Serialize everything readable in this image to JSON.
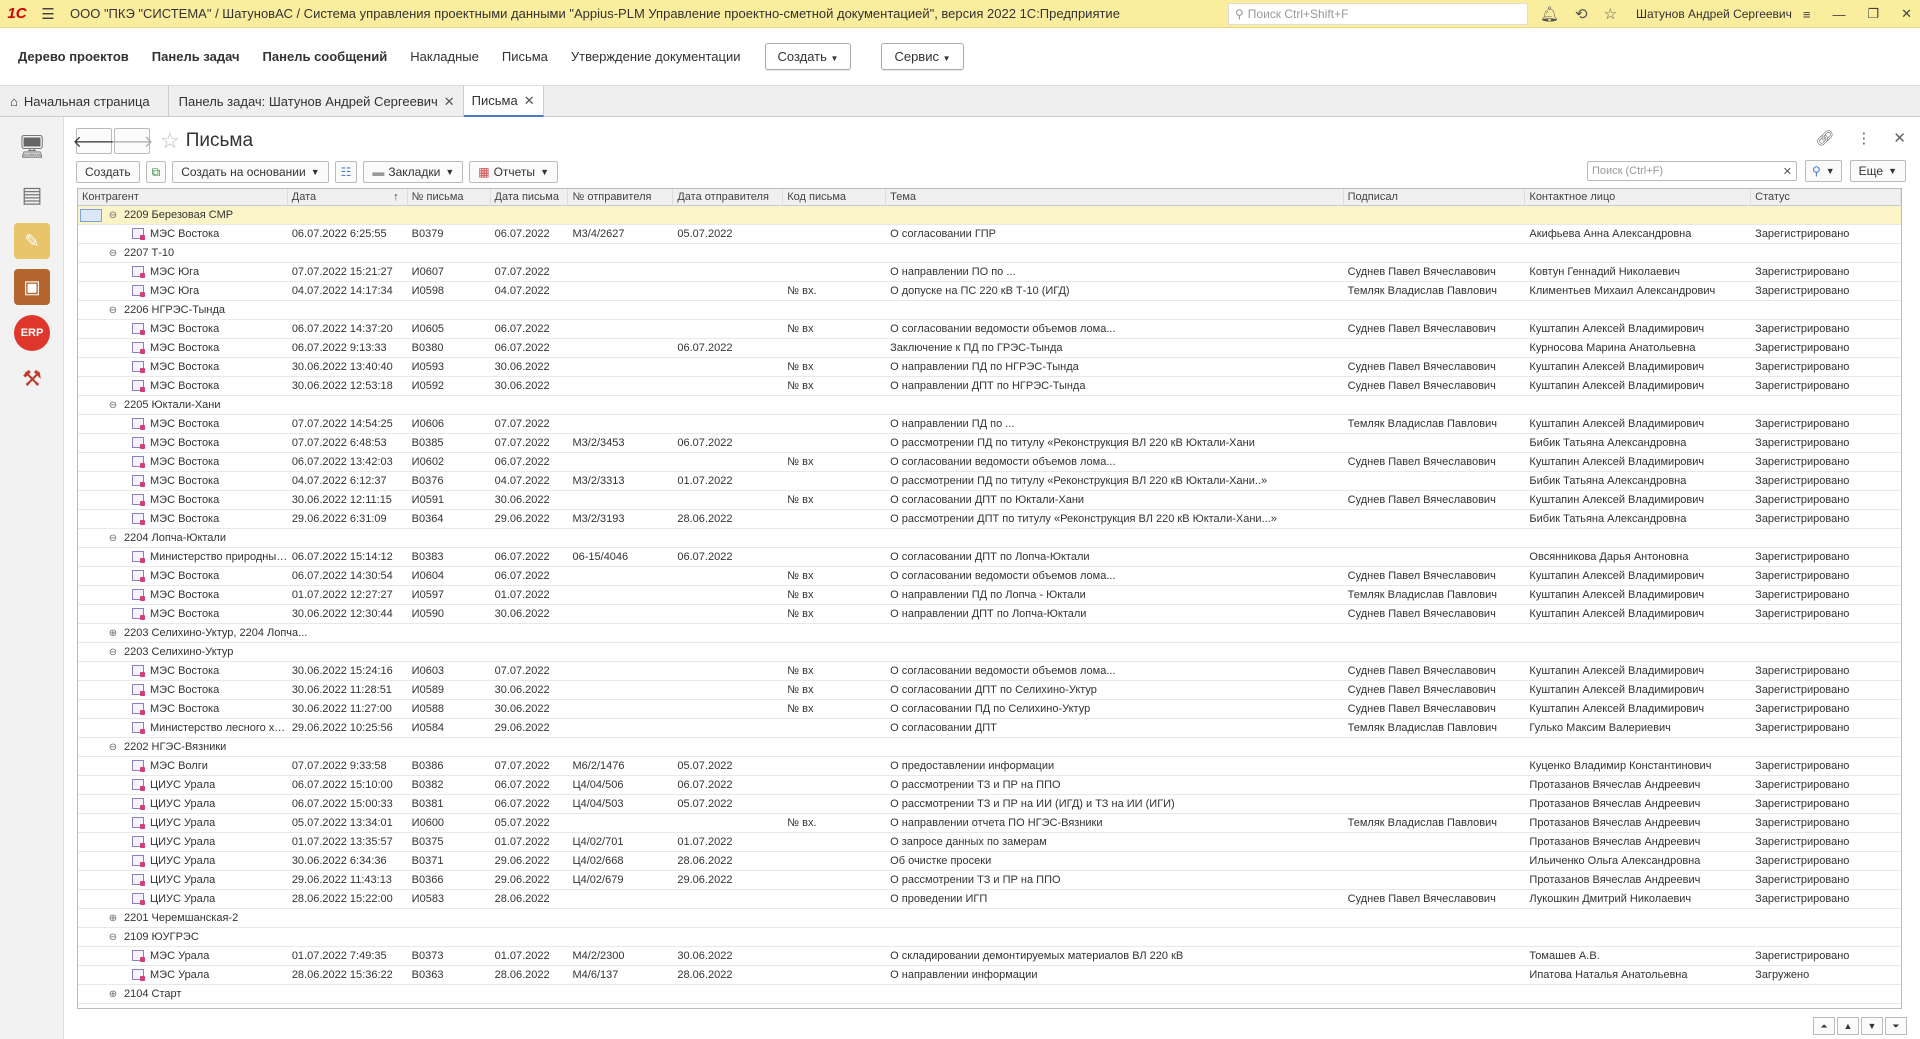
{
  "window": {
    "logo": "1С",
    "title": "ООО \"ПКЭ \"СИСТЕМА\" / ШатуновАС / Система управления проектными данными \"Appius-PLM Управление проектно-сметной документацией\", версия 2022 1С:Предприятие",
    "search_placeholder": "Поиск Ctrl+Shift+F",
    "user": "Шатунов Андрей Сергеевич"
  },
  "menu": {
    "items": [
      "Дерево проектов",
      "Панель задач",
      "Панель сообщений",
      "Накладные",
      "Письма",
      "Утверждение документации"
    ],
    "create": "Создать",
    "service": "Сервис"
  },
  "tabs": [
    "Начальная страница",
    "Панель задач: Шатунов Андрей Сергеевич",
    "Письма"
  ],
  "form": {
    "title": "Письма",
    "buttons": {
      "create": "Создать",
      "create_based": "Создать на основании",
      "bookmarks": "Закладки",
      "reports": "Отчеты",
      "more": "Еще"
    },
    "search_placeholder": "Поиск (Ctrl+F)"
  },
  "table": {
    "columns": [
      "Контрагент",
      "Дата",
      "№ письма",
      "Дата письма",
      "№ отправителя",
      "Дата отправителя",
      "Код письма",
      "Тема",
      "Подписал",
      "Контактное лицо",
      "Статус"
    ],
    "rows": [
      {
        "group": "2209 Березовая СМР",
        "open": true
      },
      {
        "cells": [
          "МЭС Востока",
          "06.07.2022 6:25:55",
          "В0379",
          "06.07.2022",
          "М3/4/2627",
          "05.07.2022",
          "",
          "О согласовании ГПР",
          "",
          "Акифьева Анна Александровна",
          "Зарегистрировано"
        ]
      },
      {
        "group": "2207 Т-10",
        "open": true
      },
      {
        "cells": [
          "МЭС Юга",
          "07.07.2022 15:21:27",
          "И0607",
          "07.07.2022",
          "",
          "",
          "",
          "О направлении ПО по ...",
          "Суднев Павел Вячеславович",
          "Ковтун Геннадий Николаевич",
          "Зарегистрировано"
        ]
      },
      {
        "cells": [
          "МЭС Юга",
          "04.07.2022 14:17:34",
          "И0598",
          "04.07.2022",
          "",
          "",
          "№ вх.",
          "О допуске на ПС 220 кВ Т-10 (ИГД)",
          "Темляк Владислав Павлович",
          "Климентьев Михаил Александрович",
          "Зарегистрировано"
        ]
      },
      {
        "group": "2206 НГРЭС-Тында",
        "open": true
      },
      {
        "cells": [
          "МЭС Востока",
          "06.07.2022 14:37:20",
          "И0605",
          "06.07.2022",
          "",
          "",
          "№ вх",
          "О согласовании ведомости объемов лома...",
          "Суднев Павел Вячеславович",
          "Куштапин Алексей Владимирович",
          "Зарегистрировано"
        ]
      },
      {
        "cells": [
          "МЭС Востока",
          "06.07.2022 9:13:33",
          "В0380",
          "06.07.2022",
          "",
          "06.07.2022",
          "",
          "Заключение к ПД по ГРЭС-Тында",
          "",
          "Курносова Марина Анатольевна",
          "Зарегистрировано"
        ]
      },
      {
        "cells": [
          "МЭС Востока",
          "30.06.2022 13:40:40",
          "И0593",
          "30.06.2022",
          "",
          "",
          "№ вх",
          "О направлении ПД по НГРЭС-Тында",
          "Суднев Павел Вячеславович",
          "Куштапин Алексей Владимирович",
          "Зарегистрировано"
        ]
      },
      {
        "cells": [
          "МЭС Востока",
          "30.06.2022 12:53:18",
          "И0592",
          "30.06.2022",
          "",
          "",
          "№ вх",
          "О направлении ДПТ по НГРЭС-Тында",
          "Суднев Павел Вячеславович",
          "Куштапин Алексей Владимирович",
          "Зарегистрировано"
        ]
      },
      {
        "group": "2205 Юктали-Хани",
        "open": true
      },
      {
        "cells": [
          "МЭС Востока",
          "07.07.2022 14:54:25",
          "И0606",
          "07.07.2022",
          "",
          "",
          "",
          "О направлении ПД по ...",
          "Темляк Владислав Павлович",
          "Куштапин Алексей Владимирович",
          "Зарегистрировано"
        ]
      },
      {
        "cells": [
          "МЭС Востока",
          "07.07.2022 6:48:53",
          "В0385",
          "07.07.2022",
          "М3/2/3453",
          "06.07.2022",
          "",
          "О рассмотрении ПД по титулу «Реконструкция ВЛ 220 кВ Юктали-Хани",
          "",
          "Бибик Татьяна Александровна",
          "Зарегистрировано"
        ]
      },
      {
        "cells": [
          "МЭС Востока",
          "06.07.2022 13:42:03",
          "И0602",
          "06.07.2022",
          "",
          "",
          "№ вх",
          "О согласовании ведомости объемов лома...",
          "Суднев Павел Вячеславович",
          "Куштапин Алексей Владимирович",
          "Зарегистрировано"
        ]
      },
      {
        "cells": [
          "МЭС Востока",
          "04.07.2022 6:12:37",
          "В0376",
          "04.07.2022",
          "М3/2/3313",
          "01.07.2022",
          "",
          "О рассмотрении ПД по титулу «Реконструкция ВЛ 220 кВ Юктали-Хани..»",
          "",
          "Бибик Татьяна Александровна",
          "Зарегистрировано"
        ]
      },
      {
        "cells": [
          "МЭС Востока",
          "30.06.2022 12:11:15",
          "И0591",
          "30.06.2022",
          "",
          "",
          "№ вх",
          "О согласовании ДПТ по Юктали-Хани",
          "Суднев Павел Вячеславович",
          "Куштапин Алексей Владимирович",
          "Зарегистрировано"
        ]
      },
      {
        "cells": [
          "МЭС Востока",
          "29.06.2022 6:31:09",
          "В0364",
          "29.06.2022",
          "М3/2/3193",
          "28.06.2022",
          "",
          "О рассмотрении ДПТ по титулу «Реконструкция ВЛ 220 кВ Юктали-Хани...»",
          "",
          "Бибик Татьяна Александровна",
          "Зарегистрировано"
        ]
      },
      {
        "group": "2204 Лопча-Юктали",
        "open": true
      },
      {
        "cells": [
          "Министерство природных...",
          "06.07.2022 15:14:12",
          "В0383",
          "06.07.2022",
          "06-15/4046",
          "06.07.2022",
          "",
          "О согласовании ДПТ по Лопча-Юктали",
          "",
          "Овсянникова Дарья Антоновна",
          "Зарегистрировано"
        ]
      },
      {
        "cells": [
          "МЭС Востока",
          "06.07.2022 14:30:54",
          "И0604",
          "06.07.2022",
          "",
          "",
          "№ вх",
          "О согласовании ведомости объемов лома...",
          "Суднев Павел Вячеславович",
          "Куштапин Алексей Владимирович",
          "Зарегистрировано"
        ]
      },
      {
        "cells": [
          "МЭС Востока",
          "01.07.2022 12:27:27",
          "И0597",
          "01.07.2022",
          "",
          "",
          "№ вх",
          "О направлении ПД по Лопча - Юктали",
          "Темляк Владислав Павлович",
          "Куштапин Алексей Владимирович",
          "Зарегистрировано"
        ]
      },
      {
        "cells": [
          "МЭС Востока",
          "30.06.2022 12:30:44",
          "И0590",
          "30.06.2022",
          "",
          "",
          "№ вх",
          "О направлении ДПТ по Лопча-Юктали",
          "Суднев Павел Вячеславович",
          "Куштапин Алексей Владимирович",
          "Зарегистрировано"
        ]
      },
      {
        "group": "2203 Селихино-Уктур, 2204 Лопча...",
        "open": false
      },
      {
        "group": "2203 Селихино-Уктур",
        "open": true
      },
      {
        "cells": [
          "МЭС Востока",
          "30.06.2022 15:24:16",
          "И0603",
          "07.07.2022",
          "",
          "",
          "№ вх",
          "О согласовании ведомости объемов лома...",
          "Суднев Павел Вячеславович",
          "Куштапин Алексей Владимирович",
          "Зарегистрировано"
        ]
      },
      {
        "cells": [
          "МЭС Востока",
          "30.06.2022 11:28:51",
          "И0589",
          "30.06.2022",
          "",
          "",
          "№ вх",
          "О согласовании ДПТ по Селихино-Уктур",
          "Суднев Павел Вячеславович",
          "Куштапин Алексей Владимирович",
          "Зарегистрировано"
        ]
      },
      {
        "cells": [
          "МЭС Востока",
          "30.06.2022 11:27:00",
          "И0588",
          "30.06.2022",
          "",
          "",
          "№ вх",
          "О согласовании ПД по Селихино-Уктур",
          "Суднев Павел Вячеславович",
          "Куштапин Алексей Владимирович",
          "Зарегистрировано"
        ]
      },
      {
        "cells": [
          "Министерство лесного хо...",
          "29.06.2022 10:25:56",
          "И0584",
          "29.06.2022",
          "",
          "",
          "",
          "О согласовании ДПТ",
          "Темляк Владислав Павлович",
          "Гулько Максим Валериевич",
          "Зарегистрировано"
        ]
      },
      {
        "group": "2202 НГЭС-Вязники",
        "open": true
      },
      {
        "cells": [
          "МЭС Волги",
          "07.07.2022 9:33:58",
          "В0386",
          "07.07.2022",
          "М6/2/1476",
          "05.07.2022",
          "",
          "О предоставлении информации",
          "",
          "Куценко Владимир Константинович",
          "Зарегистрировано"
        ]
      },
      {
        "cells": [
          "ЦИУС Урала",
          "06.07.2022 15:10:00",
          "В0382",
          "06.07.2022",
          "Ц4/04/506",
          "06.07.2022",
          "",
          "О рассмотрении ТЗ и ПР на ППО",
          "",
          "Протазанов Вячеслав Андреевич",
          "Зарегистрировано"
        ]
      },
      {
        "cells": [
          "ЦИУС Урала",
          "06.07.2022 15:00:33",
          "В0381",
          "06.07.2022",
          "Ц4/04/503",
          "05.07.2022",
          "",
          "О рассмотрении ТЗ и ПР на ИИ (ИГД) и ТЗ на ИИ (ИГИ)",
          "",
          "Протазанов Вячеслав Андреевич",
          "Зарегистрировано"
        ]
      },
      {
        "cells": [
          "ЦИУС Урала",
          "05.07.2022 13:34:01",
          "И0600",
          "05.07.2022",
          "",
          "",
          "№ вх.",
          "О направлении отчета ПО НГЭС-Вязники",
          "Темляк Владислав Павлович",
          "Протазанов Вячеслав Андреевич",
          "Зарегистрировано"
        ]
      },
      {
        "cells": [
          "ЦИУС Урала",
          "01.07.2022 13:35:57",
          "В0375",
          "01.07.2022",
          "Ц4/02/701",
          "01.07.2022",
          "",
          "О запросе данных по замерам",
          "",
          "Протазанов Вячеслав Андреевич",
          "Зарегистрировано"
        ]
      },
      {
        "cells": [
          "ЦИУС Урала",
          "30.06.2022 6:34:36",
          "В0371",
          "29.06.2022",
          "Ц4/02/668",
          "28.06.2022",
          "",
          "Об очистке просеки",
          "",
          "Ильиченко Ольга Александровна",
          "Зарегистрировано"
        ]
      },
      {
        "cells": [
          "ЦИУС Урала",
          "29.06.2022 11:43:13",
          "В0366",
          "29.06.2022",
          "Ц4/02/679",
          "29.06.2022",
          "",
          "О рассмотрении ТЗ и ПР на ППО",
          "",
          "Протазанов Вячеслав Андреевич",
          "Зарегистрировано"
        ]
      },
      {
        "cells": [
          "ЦИУС Урала",
          "28.06.2022 15:22:00",
          "И0583",
          "28.06.2022",
          "",
          "",
          "",
          "О проведении ИГП",
          "Суднев Павел Вячеславович",
          "Лукошкин Дмитрий Николаевич",
          "Зарегистрировано"
        ]
      },
      {
        "group": "2201 Черемшанская-2",
        "open": false
      },
      {
        "group": "2109 ЮУГРЭС",
        "open": true
      },
      {
        "cells": [
          "МЭС Урала",
          "01.07.2022 7:49:35",
          "В0373",
          "01.07.2022",
          "М4/2/2300",
          "30.06.2022",
          "",
          "О складировании демонтируемых материалов ВЛ 220 кВ",
          "",
          "Томашев А.В.",
          "Зарегистрировано"
        ]
      },
      {
        "cells": [
          "МЭС Урала",
          "28.06.2022 15:36:22",
          "В0363",
          "28.06.2022",
          "М4/6/137",
          "28.06.2022",
          "",
          "О направлении информации",
          "",
          "Ипатова Наталья Анатольевна",
          "Загружено"
        ]
      },
      {
        "group": "2104 Старт",
        "open": false
      }
    ]
  },
  "colors": {
    "titlebar": "#fbed9e",
    "selection": "#fbf4c9",
    "accent": "#4a7cc8",
    "erp": "#e0372d"
  }
}
